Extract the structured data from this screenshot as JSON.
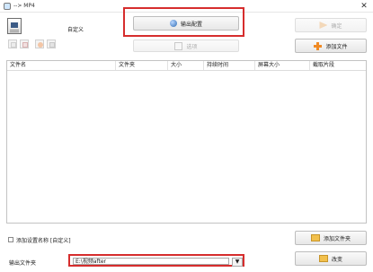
{
  "window": {
    "title": "--> MP4",
    "close_glyph": "✕"
  },
  "profile": {
    "name": "自定义"
  },
  "toolbar": {
    "output_config_label": "输出配置",
    "ok_label": "确定",
    "option_label": "选项",
    "add_file_label": "添加文件"
  },
  "file_list": {
    "columns": [
      "文件名",
      "文件夹",
      "大小",
      "持续时间",
      "屏幕大小",
      "截取片段"
    ]
  },
  "footer": {
    "save_settings_label": "添加设置名称 [自定义]",
    "save_settings_checked": false,
    "add_folder_label": "添加文件夹",
    "output_folder_label": "输出文件夹",
    "output_folder_value": "E:\\视频after",
    "change_label": "改变"
  },
  "colors": {
    "highlight": "#d62d2d",
    "add_icon": "#f08a24",
    "folder_icon": "#f2c04c"
  }
}
